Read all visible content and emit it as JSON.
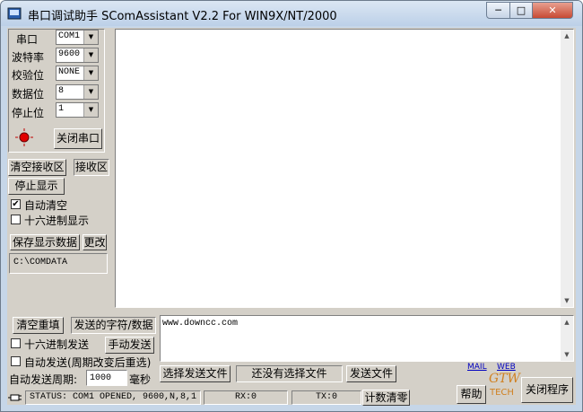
{
  "window": {
    "title": "串口调试助手 SComAssistant V2.2 For WIN9X/NT/2000",
    "minimize": "─",
    "maximize": "□",
    "close": "✕"
  },
  "settings": {
    "port_label": "串口",
    "port_value": "COM1",
    "baud_label": "波特率",
    "baud_value": "9600",
    "parity_label": "校验位",
    "parity_value": "NONE",
    "databits_label": "数据位",
    "databits_value": "8",
    "stopbits_label": "停止位",
    "stopbits_value": "1",
    "close_port_button": "关闭串口"
  },
  "receive": {
    "clear_button": "清空接收区",
    "area_label": "接收区",
    "stop_display_button": "停止显示",
    "auto_clear_label": "自动清空",
    "auto_clear_checked": true,
    "hex_display_label": "十六进制显示",
    "hex_display_checked": false,
    "save_button": "保存显示数据",
    "change_button": "更改",
    "save_path": "C:\\COMDATA",
    "content": ""
  },
  "send": {
    "clear_resend_button": "清空重填",
    "area_label": "发送的字符/数据",
    "hex_send_label": "十六进制发送",
    "hex_send_checked": false,
    "manual_send_button": "手动发送",
    "auto_send_label": "自动发送(周期改变后重选)",
    "auto_send_checked": false,
    "period_label": "自动发送周期:",
    "period_value": "1000",
    "period_unit": "毫秒",
    "content": "www.downcc.com",
    "select_file_button": "选择发送文件",
    "file_status": "还没有选择文件",
    "send_file_button": "发送文件"
  },
  "status": {
    "text": "STATUS: COM1 OPENED, 9600,N,8,1",
    "rx": "RX:0",
    "tx": "TX:0",
    "reset_count_button": "计数清零",
    "mail_link": "MAIL",
    "web_link": "WEB",
    "help_button": "帮助",
    "close_program_button": "关闭程序",
    "logo_text": "GTW",
    "logo_sub": "TECH"
  }
}
